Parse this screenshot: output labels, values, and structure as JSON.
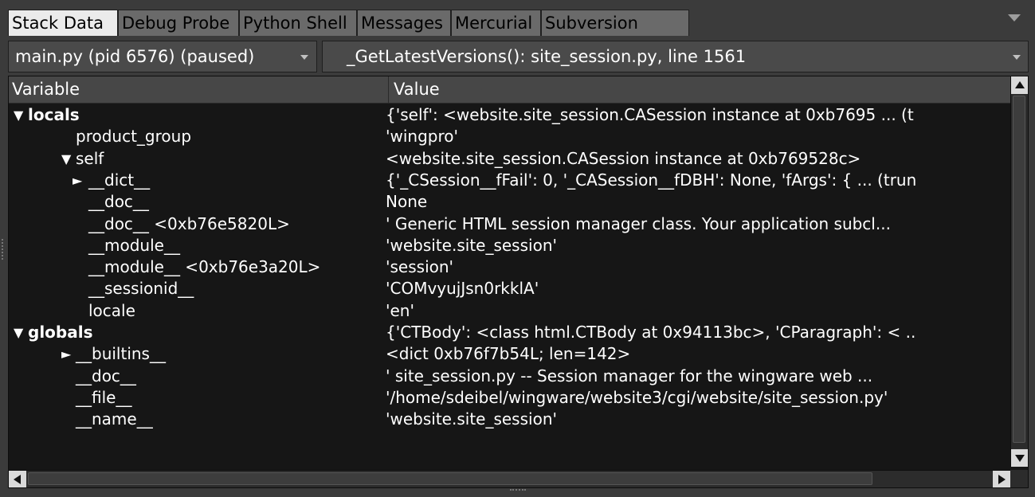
{
  "tabs": [
    {
      "label": "Stack Data",
      "active": true
    },
    {
      "label": "Debug Probe",
      "active": false
    },
    {
      "label": "Python Shell",
      "active": false
    },
    {
      "label": "Messages",
      "active": false
    },
    {
      "label": "Mercurial",
      "active": false
    },
    {
      "label": "Subversion",
      "active": false
    }
  ],
  "process_selector": {
    "value": "main.py (pid 6576) (paused)"
  },
  "frame_selector": {
    "value": "_GetLatestVersions(): site_session.py, line 1561"
  },
  "grid": {
    "columns": {
      "variable": "Variable",
      "value": "Value"
    },
    "rows": [
      {
        "name": "locals",
        "value": "{'self': <website.site_session.CASession instance at 0xb7695 ... (t",
        "level": 0,
        "expander": "expanded",
        "bold": true
      },
      {
        "name": "product_group",
        "value": "'wingpro'",
        "level": 1,
        "expander": "none",
        "bold": false
      },
      {
        "name": "self",
        "value": "<website.site_session.CASession instance at 0xb769528c>",
        "level": 1,
        "expander": "expanded",
        "bold": false
      },
      {
        "name": "__dict__",
        "value": "{'_CSession__fFail': 0, '_CASession__fDBH': None, 'fArgs': { ... (trun",
        "level": 2,
        "expander": "collapsed",
        "bold": false
      },
      {
        "name": "__doc__",
        "value": "None",
        "level": 2,
        "expander": "none",
        "bold": false
      },
      {
        "name": "__doc__ <0xb76e5820L>",
        "value": "' Generic HTML session manager class.  Your application subcl...",
        "level": 2,
        "expander": "none",
        "bold": false
      },
      {
        "name": "__module__",
        "value": "'website.site_session'",
        "level": 2,
        "expander": "none",
        "bold": false
      },
      {
        "name": "__module__ <0xb76e3a20L>",
        "value": "'session'",
        "level": 2,
        "expander": "none",
        "bold": false
      },
      {
        "name": "__sessionid__",
        "value": "'COMvyujJsn0rkklA'",
        "level": 2,
        "expander": "none",
        "bold": false
      },
      {
        "name": "locale",
        "value": "'en'",
        "level": 2,
        "expander": "none",
        "bold": false
      },
      {
        "name": "globals",
        "value": "{'CTBody': <class html.CTBody at 0x94113bc>, 'CParagraph': < ..",
        "level": 0,
        "expander": "expanded",
        "bold": true
      },
      {
        "name": "__builtins__",
        "value": "<dict 0xb76f7b54L; len=142>",
        "level": 1,
        "expander": "collapsed",
        "bold": false
      },
      {
        "name": "__doc__",
        "value": "' site_session.py    -- Session manager for the wingware web ...",
        "level": 1,
        "expander": "none",
        "bold": false
      },
      {
        "name": "__file__",
        "value": "'/home/sdeibel/wingware/website3/cgi/website/site_session.py'",
        "level": 1,
        "expander": "none",
        "bold": false
      },
      {
        "name": "__name__",
        "value": "'website.site_session'",
        "level": 1,
        "expander": "none",
        "bold": false
      }
    ]
  },
  "icons": {
    "expanded": "▼",
    "collapsed": "►"
  },
  "colors": {
    "panel_bg": "#3b3b3b",
    "grid_bg": "#161616",
    "active_tab": "#ebebeb",
    "inactive_tab": "#6a6a6a"
  }
}
